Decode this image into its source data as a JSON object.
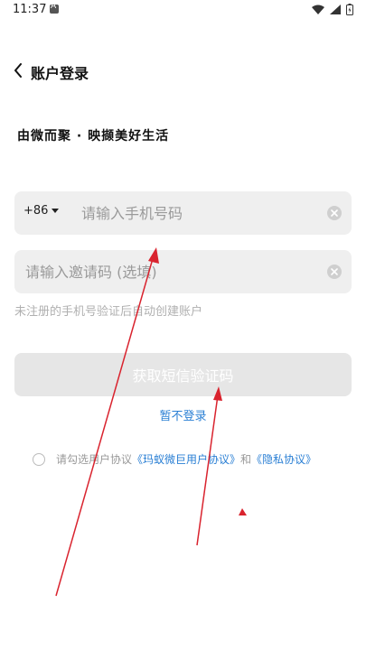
{
  "status": {
    "time": "11:37"
  },
  "header": {
    "title": "账户登录"
  },
  "slogan": "由微而聚 · 映撷美好生活",
  "phone": {
    "country_code": "+86",
    "placeholder": "请输入手机号码"
  },
  "invite": {
    "placeholder": "请输入邀请码 (选填)"
  },
  "hint": "未注册的手机号验证后自动创建账户",
  "get_code_button": "获取短信验证码",
  "skip_login": "暂不登录",
  "agreement": {
    "prefix": "请勾选用户协议",
    "user_agreement": "《玛蚁微巨用户协议》",
    "and": "和",
    "privacy": "《隐私协议》"
  },
  "colors": {
    "link": "#2a7fd4",
    "annotation": "#d9232e",
    "field_bg": "#efefef"
  }
}
